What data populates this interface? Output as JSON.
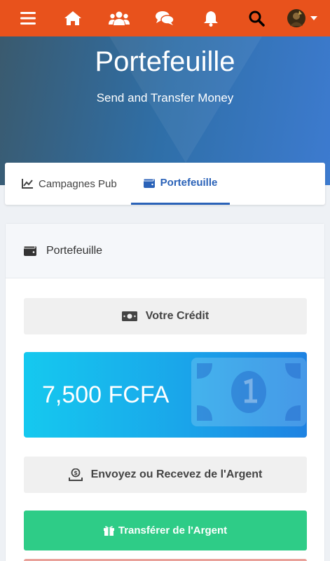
{
  "nav": {
    "icons": [
      "menu-icon",
      "home-icon",
      "users-icon",
      "chat-icon",
      "bell-icon",
      "search-icon",
      "avatar"
    ],
    "accent": "#e8521c"
  },
  "hero": {
    "title": "Portefeuille",
    "subtitle": "Send and Transfer Money"
  },
  "tabs": [
    {
      "label": "Campagnes Pub",
      "icon": "line-chart-icon",
      "active": false
    },
    {
      "label": "Portefeuille",
      "icon": "wallet-icon",
      "active": true
    }
  ],
  "wallet": {
    "header": "Portefeuille",
    "credit_label": "Votre Crédit",
    "balance": "7,500 FCFA",
    "send_receive_label": "Envoyez ou Recevez de l'Argent",
    "transfer_button": "Transférer de l'Argent"
  },
  "colors": {
    "primary_blue": "#2a62b8",
    "success_green": "#2ecc87",
    "credit_gradient_start": "#15c9ef",
    "credit_gradient_end": "#1e82e2"
  }
}
